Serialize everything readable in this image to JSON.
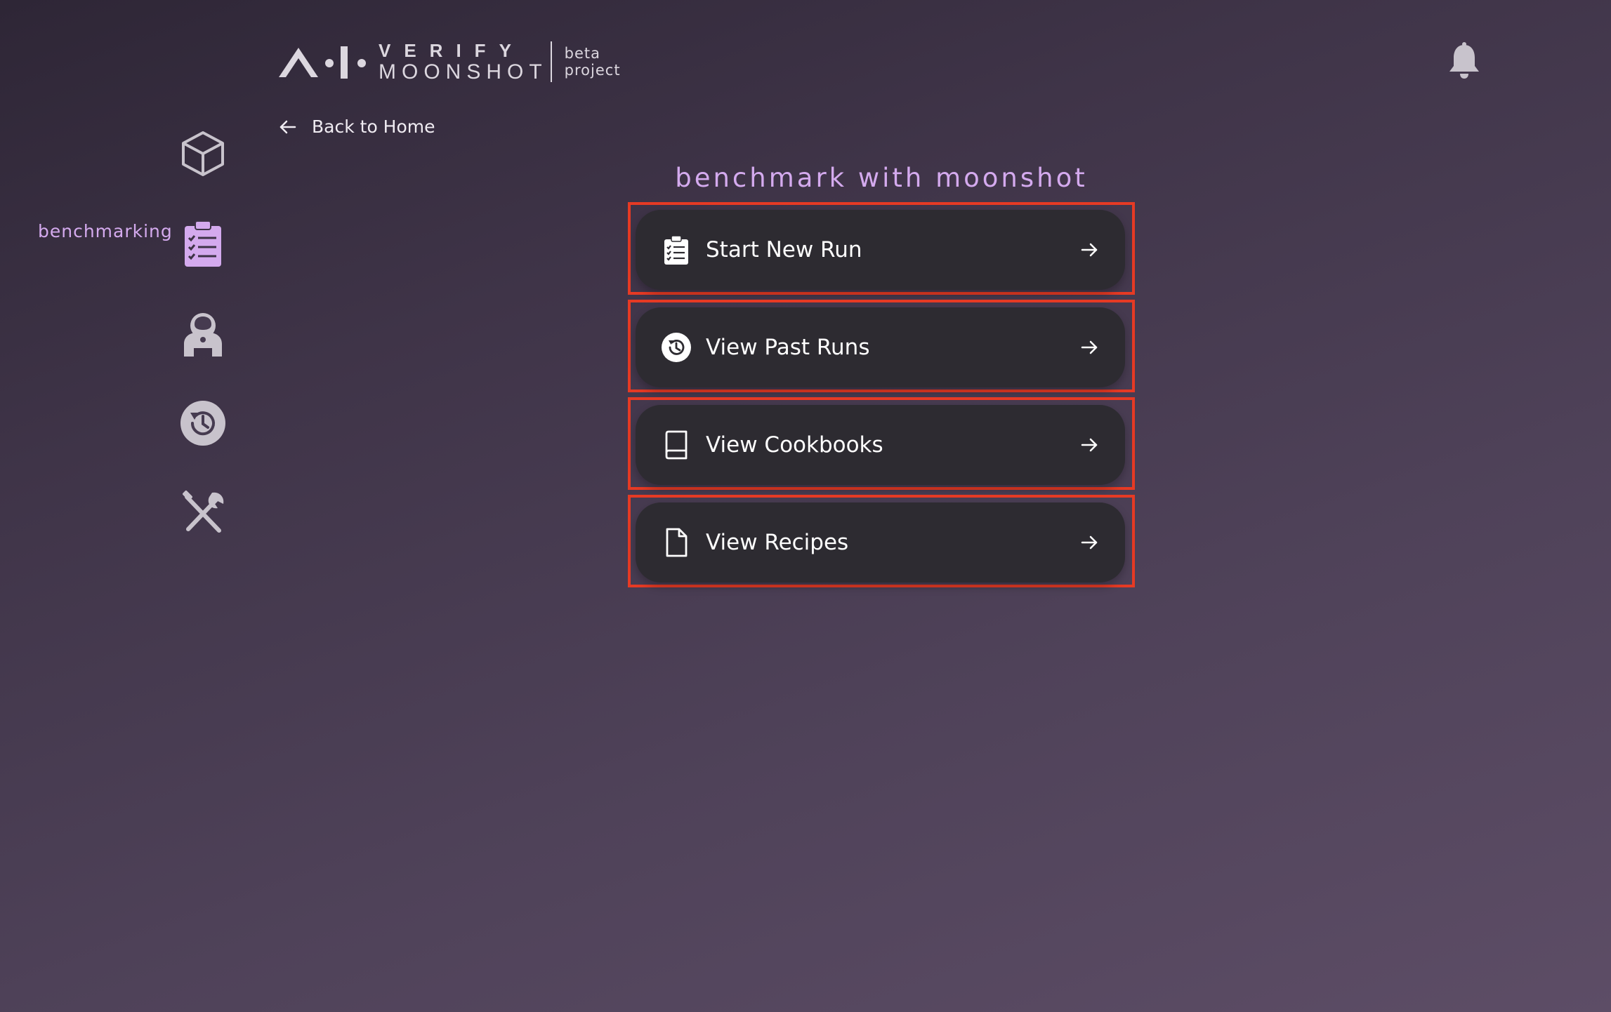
{
  "header": {
    "logo_line1": "VERIFY",
    "logo_line2": "MOONSHOT",
    "logo_tag1": "beta",
    "logo_tag2": "project",
    "bell_icon": "bell-icon"
  },
  "sidebar": {
    "active_label": "benchmarking",
    "items": [
      {
        "icon": "cube-icon"
      },
      {
        "icon": "clipboard-list-icon",
        "active": true
      },
      {
        "icon": "astronaut-icon"
      },
      {
        "icon": "history-icon"
      },
      {
        "icon": "tools-icon"
      }
    ]
  },
  "nav": {
    "back_label": "Back to Home"
  },
  "main": {
    "title": "benchmark with moonshot",
    "items": [
      {
        "label": "Start New Run",
        "icon": "clipboard-check-icon"
      },
      {
        "label": "View Past Runs",
        "icon": "history-icon"
      },
      {
        "label": "View Cookbooks",
        "icon": "book-icon"
      },
      {
        "label": "View Recipes",
        "icon": "file-icon"
      }
    ]
  },
  "colors": {
    "accent": "#d4aaee",
    "highlight_border": "#e63a24",
    "pill_bg": "#2d2b31",
    "icon_muted": "#c8c3cc"
  }
}
